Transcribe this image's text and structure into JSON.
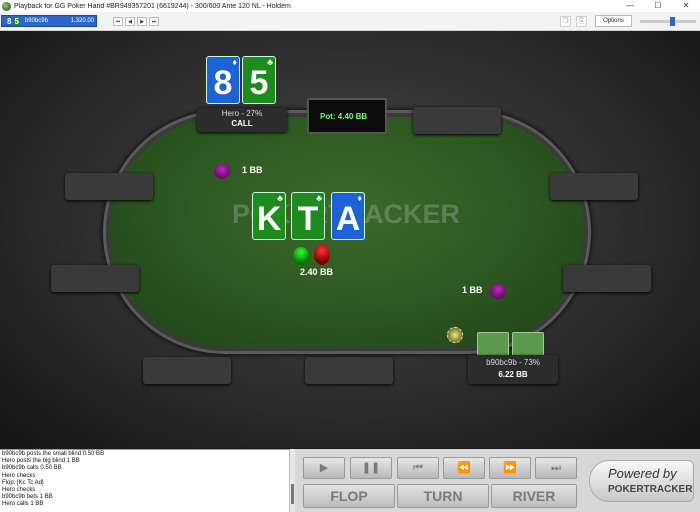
{
  "window": {
    "title": "Playback for GG Poker Hand #BR949357201 (6619244) - 300/600 Ante 120 NL - Holdem",
    "minimize": "—",
    "maximize": "☐",
    "close": "✕"
  },
  "toolbar": {
    "hand_card1": "8",
    "hand_card2": "5",
    "hand_id": "b90bc9b",
    "hand_amount": "1,320.00",
    "options_label": "Options",
    "nav": [
      "⏮",
      "◀",
      "▶",
      "⏭"
    ]
  },
  "table": {
    "pot": "Pot: 4.40 BB",
    "watermark": "POKERTRACKER",
    "hero": {
      "cards": [
        {
          "rank": "8",
          "suit": "♦",
          "color": "#1b62d8"
        },
        {
          "rank": "5",
          "suit": "♣",
          "color": "#1e8b1e"
        }
      ],
      "name": "Hero - 27%",
      "action": "CALL"
    },
    "board": [
      {
        "rank": "K",
        "suit": "♣",
        "color": "#1e8b1e"
      },
      {
        "rank": "T",
        "suit": "♣",
        "color": "#1e8b1e"
      },
      {
        "rank": "A",
        "suit": "♦",
        "color": "#1b62d8"
      }
    ],
    "villain": {
      "name": "b90bc9b - 73%",
      "stack": "6.22 BB"
    },
    "bets": {
      "hero_blind": "1 BB",
      "villain_blind": "1 BB",
      "center_bet": "2.40 BB"
    }
  },
  "log": [
    "b90bc9b posts the small blind 0.50 BB",
    "Hero posts the big blind 1 BB",
    "b90bc9b calls 0.50 BB",
    "Hero checks",
    "Flop: [Kc Tc Ad]",
    "Hero checks",
    "b90bc9b bets 1 BB",
    "Hero calls 1 BB"
  ],
  "controls": {
    "play": "▶",
    "pause": "❚❚",
    "first": "⏮",
    "prev": "⏪",
    "next": "⏩",
    "last": "⏭",
    "flop": "FLOP",
    "turn": "TURN",
    "river": "RIVER"
  },
  "branding": {
    "line1": "Powered by",
    "line2": "POKERTRACKER"
  },
  "colors": {
    "felt": "#2c5620",
    "pot_text": "#66ff66",
    "club": "#1e8b1e",
    "diamond": "#1b62d8"
  }
}
